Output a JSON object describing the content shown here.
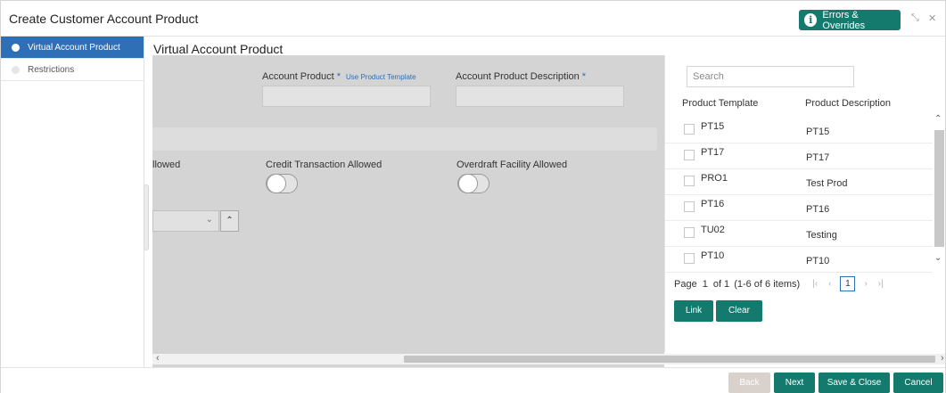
{
  "window": {
    "title": "Create Customer Account Product",
    "errors_label": "Errors & Overrides",
    "info_glyph": "i"
  },
  "sidebar": {
    "items": [
      {
        "label": "Virtual Account Product",
        "active": true
      },
      {
        "label": "Restrictions",
        "active": false
      }
    ]
  },
  "main": {
    "title": "Virtual Account Product",
    "account_product_label": "Account Product",
    "required_mark": "*",
    "use_template_link": "Use Product Template",
    "account_product_desc_label": "Account Product Description",
    "debit_label_partial": "llowed",
    "credit_label": "Credit Transaction Allowed",
    "overdraft_label": "Overdraft Facility Allowed"
  },
  "panel": {
    "search_placeholder": "Search",
    "col_template": "Product Template",
    "col_description": "Product Description",
    "rows": [
      {
        "template": "PT15",
        "description": "PT15"
      },
      {
        "template": "PT17",
        "description": "PT17"
      },
      {
        "template": "PRO1",
        "description": "Test Prod"
      },
      {
        "template": "PT16",
        "description": "PT16"
      },
      {
        "template": "TU02",
        "description": "Testing"
      },
      {
        "template": "PT10",
        "description": "PT10"
      }
    ],
    "pager": {
      "page_label": "Page",
      "page": "1",
      "of_label": "of 1",
      "items_label": "(1-6 of 6 items)",
      "current": "1"
    },
    "link_label": "Link",
    "clear_label": "Clear"
  },
  "footer": {
    "back": "Back",
    "next": "Next",
    "save_close": "Save & Close",
    "cancel": "Cancel"
  },
  "colors": {
    "accent": "#157a6e",
    "active_nav": "#2f6fb5"
  }
}
